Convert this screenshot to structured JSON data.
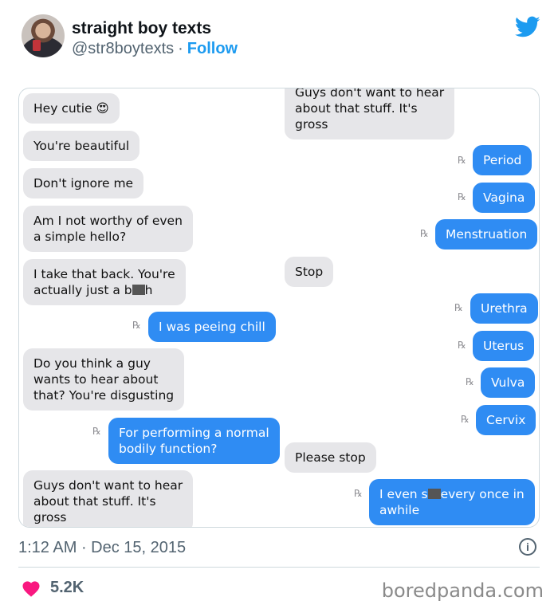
{
  "tweet": {
    "display_name": "straight boy texts",
    "handle": "@str8boytexts",
    "separator": "·",
    "follow_label": "Follow",
    "time": "1:12 AM",
    "date": "Dec 15, 2015",
    "likes": "5.2K"
  },
  "conversation": {
    "receipt_glyph": "℞",
    "left": [
      {
        "side": "them",
        "text": "Hey cutie 😍"
      },
      {
        "side": "them",
        "text": "You're beautiful"
      },
      {
        "side": "them",
        "text": "Don't ignore me"
      },
      {
        "side": "them",
        "lines": [
          "Am I not worthy of even",
          "a simple hello?"
        ]
      },
      {
        "side": "them",
        "lines": [
          "I take that back. You're",
          "actually just a b",
          "h"
        ]
      },
      {
        "side": "me",
        "text": "I was peeing chill"
      },
      {
        "side": "them",
        "lines": [
          "Do you think a guy",
          "wants to hear about",
          "that? You're disgusting"
        ]
      },
      {
        "side": "me",
        "lines": [
          "For performing a normal",
          "bodily function?"
        ]
      },
      {
        "side": "them",
        "lines": [
          "Guys don't want to hear",
          "about that stuff. It's",
          "gross"
        ]
      }
    ],
    "right": [
      {
        "side": "them",
        "lines": [
          "Guys don't want to hear",
          "about that stuff. It's",
          "gross"
        ]
      },
      {
        "side": "me",
        "text": "Period"
      },
      {
        "side": "me",
        "text": "Vagina"
      },
      {
        "side": "me",
        "text": "Menstruation"
      },
      {
        "side": "them",
        "text": "Stop"
      },
      {
        "side": "me",
        "text": "Urethra"
      },
      {
        "side": "me",
        "text": "Uterus"
      },
      {
        "side": "me",
        "text": "Vulva"
      },
      {
        "side": "me",
        "text": "Cervix"
      },
      {
        "side": "them",
        "text": "Please stop"
      },
      {
        "side": "me",
        "lines": [
          "I even s",
          "every once in",
          "awhile"
        ]
      }
    ]
  },
  "footer": {
    "watermark": "boredpanda.com",
    "info_icon": "info-icon",
    "heart_icon": "heart-icon"
  },
  "colors": {
    "twitter_blue": "#1d9bf0",
    "imessage_blue": "#2f8cf3",
    "bubble_gray": "#e6e6e9",
    "heart": "#f91880"
  }
}
